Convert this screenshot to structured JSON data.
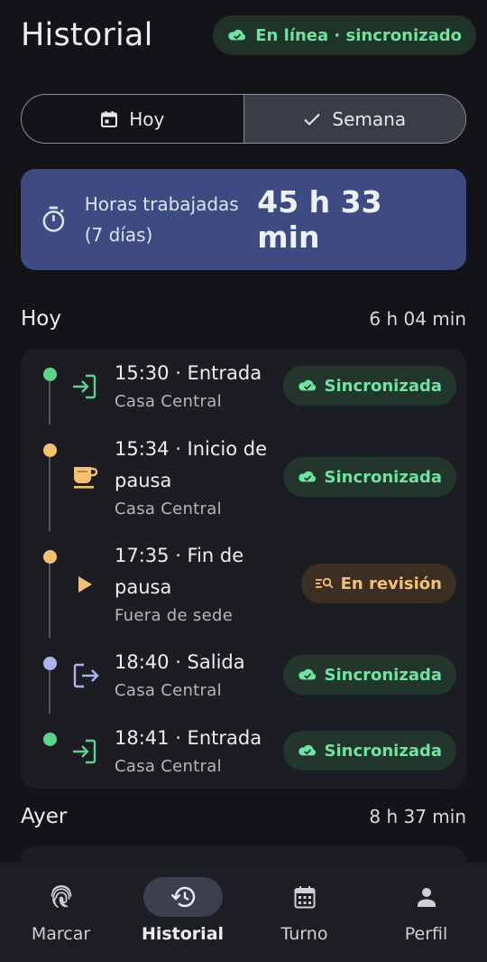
{
  "header": {
    "title": "Historial",
    "sync_status": "En línea · sincronizado",
    "sync_icon": "cloud-check-icon"
  },
  "tabs": [
    {
      "label": "Hoy",
      "icon": "calendar-icon",
      "selected": false
    },
    {
      "label": "Semana",
      "icon": "check-icon",
      "selected": true
    }
  ],
  "summary": {
    "label": "Horas trabajadas (7 días)",
    "value": "45 h 33 min",
    "icon": "timer-icon"
  },
  "today": {
    "title": "Hoy",
    "total": "6 h 04 min",
    "entries": [
      {
        "time_title": "15:30 · Entrada",
        "location": "Casa Central",
        "status": "Sincronizada",
        "kind": "entrada",
        "dot_color": "#5fd38d"
      },
      {
        "time_title": "15:34 · Inicio de pausa",
        "location": "Casa Central",
        "status": "Sincronizada",
        "kind": "pausa-inicio",
        "dot_color": "#f5c070"
      },
      {
        "time_title": "17:35 · Fin de pausa",
        "location": "Fuera de sede",
        "status": "En revisión",
        "kind": "pausa-fin",
        "dot_color": "#f5c070"
      },
      {
        "time_title": "18:40 · Salida",
        "location": "Casa Central",
        "status": "Sincronizada",
        "kind": "salida",
        "dot_color": "#aab4f0"
      },
      {
        "time_title": "18:41 · Entrada",
        "location": "Casa Central",
        "status": "Sincronizada",
        "kind": "entrada",
        "dot_color": "#5fd38d"
      }
    ]
  },
  "yesterday": {
    "title": "Ayer",
    "total": "8 h 37 min"
  },
  "nav": [
    {
      "label": "Marcar",
      "icon": "fingerprint-icon",
      "active": false
    },
    {
      "label": "Historial",
      "icon": "history-icon",
      "active": true
    },
    {
      "label": "Turno",
      "icon": "calendar-grid-icon",
      "active": false
    },
    {
      "label": "Perfil",
      "icon": "person-icon",
      "active": false
    }
  ],
  "colors": {
    "background": "#131418",
    "accent_card": "#3e4a82",
    "success": "#6fe3a0",
    "warning": "#f5c070"
  }
}
